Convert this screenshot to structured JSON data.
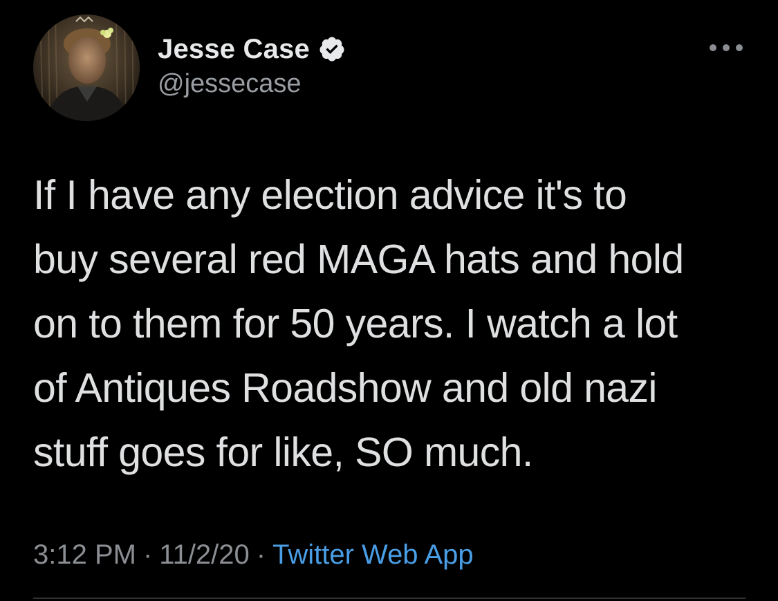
{
  "user": {
    "display_name": "Jesse Case",
    "handle": "@jessecase",
    "verified": true
  },
  "tweet": {
    "text": "If I have any election advice it's to\nbuy several red MAGA hats and hold\non to them for 50 years. I watch a lot\nof Antiques Roadshow and old nazi\nstuff goes for like, SO much."
  },
  "meta": {
    "time": "3:12 PM",
    "separator": "·",
    "date": "11/2/20",
    "source": "Twitter Web App"
  },
  "icons": {
    "verified": "verified-badge-icon",
    "more": "more-options-icon"
  },
  "colors": {
    "background": "#000000",
    "text": "#dfe0e1",
    "secondary": "#8b8f93",
    "link": "#4a9ee6"
  }
}
